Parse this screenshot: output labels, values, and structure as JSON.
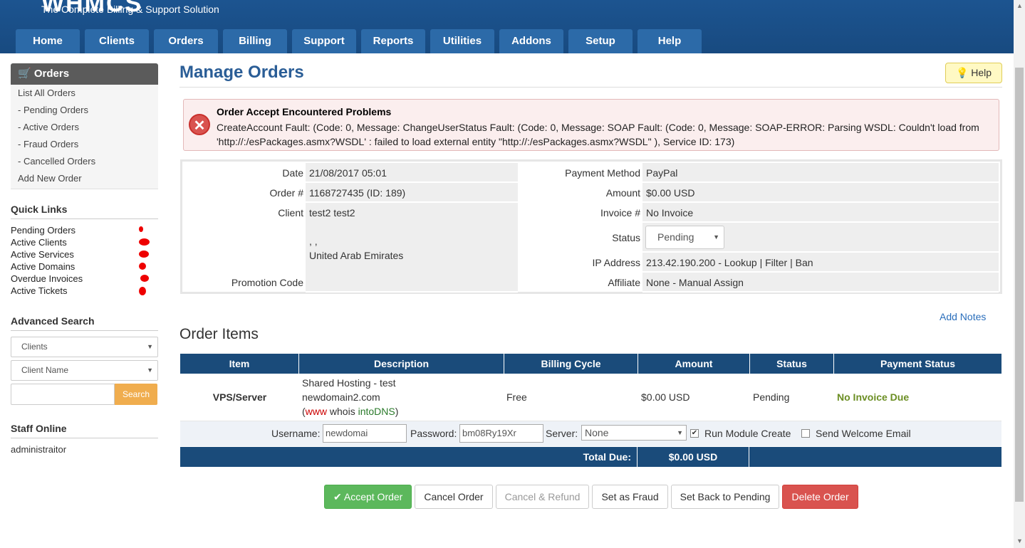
{
  "brand": {
    "tagline": "The Complete Billing & Support Solution"
  },
  "nav": [
    "Home",
    "Clients",
    "Orders",
    "Billing",
    "Support",
    "Reports",
    "Utilities",
    "Addons",
    "Setup",
    "Help"
  ],
  "sidebar": {
    "header": "Orders",
    "menu": [
      "List All Orders",
      "- Pending Orders",
      "- Active Orders",
      "- Fraud Orders",
      "- Cancelled Orders",
      "Add New Order"
    ],
    "quick_links_title": "Quick Links",
    "quick_links": [
      "Pending Orders",
      "Active Clients",
      "Active Services",
      "Active Domains",
      "Overdue Invoices",
      "Active Tickets"
    ],
    "advanced_search_title": "Advanced Search",
    "search_type": "Clients",
    "search_field": "Client Name",
    "search_button": "Search",
    "staff_title": "Staff Online",
    "staff": "administraitor"
  },
  "page": {
    "title": "Manage Orders",
    "help": "Help"
  },
  "alert": {
    "title": "Order Accept Encountered Problems",
    "message": "CreateAccount Fault: (Code: 0, Message: ChangeUserStatus Fault: (Code: 0, Message: SOAP Fault: (Code: 0, Message: SOAP-ERROR: Parsing WSDL: Couldn't load from 'http://:/esPackages.asmx?WSDL' : failed to load external entity \"http://:/esPackages.asmx?WSDL\" ), Service ID: 173)"
  },
  "order": {
    "date_label": "Date",
    "date": "21/08/2017 05:01",
    "order_label": "Order #",
    "order": "1168727435 (ID: 189)",
    "client_label": "Client",
    "client_name": "test2 test2",
    "client_addr": ", ,",
    "client_country": "United Arab Emirates",
    "promo_label": "Promotion Code",
    "promo": "",
    "payment_label": "Payment Method",
    "payment": "PayPal",
    "amount_label": "Amount",
    "amount": "$0.00 USD",
    "invoice_label": "Invoice #",
    "invoice": "No Invoice",
    "status_label": "Status",
    "status": "Pending",
    "ip_label": "IP Address",
    "ip": "213.42.190.200 - Lookup | Filter | Ban",
    "affiliate_label": "Affiliate",
    "affiliate": "None - Manual Assign"
  },
  "add_notes": "Add Notes",
  "order_items_title": "Order Items",
  "items": {
    "headers": [
      "Item",
      "Description",
      "Billing Cycle",
      "Amount",
      "Status",
      "Payment Status"
    ],
    "row": {
      "item": "VPS/Server",
      "desc_line1": "Shared Hosting - test",
      "desc_line2": "newdomain2.com",
      "desc_open": "(",
      "desc_www": "www",
      "desc_whois": "whois",
      "desc_intodns": "intoDNS",
      "desc_close": ")",
      "cycle": "Free",
      "amount": "$0.00 USD",
      "status": "Pending",
      "payment_status": "No Invoice Due"
    }
  },
  "module": {
    "username_label": "Username:",
    "username": "newdomai",
    "password_label": "Password:",
    "password": "bm08Ry19Xr",
    "server_label": "Server:",
    "server": "None",
    "run_module": "Run Module Create",
    "send_welcome": "Send Welcome Email"
  },
  "total": {
    "label": "Total Due:",
    "value": "$0.00 USD"
  },
  "actions": {
    "accept": "Accept Order",
    "cancel": "Cancel Order",
    "cancel_refund": "Cancel & Refund",
    "fraud": "Set as Fraud",
    "pending": "Set Back to Pending",
    "delete": "Delete Order"
  }
}
